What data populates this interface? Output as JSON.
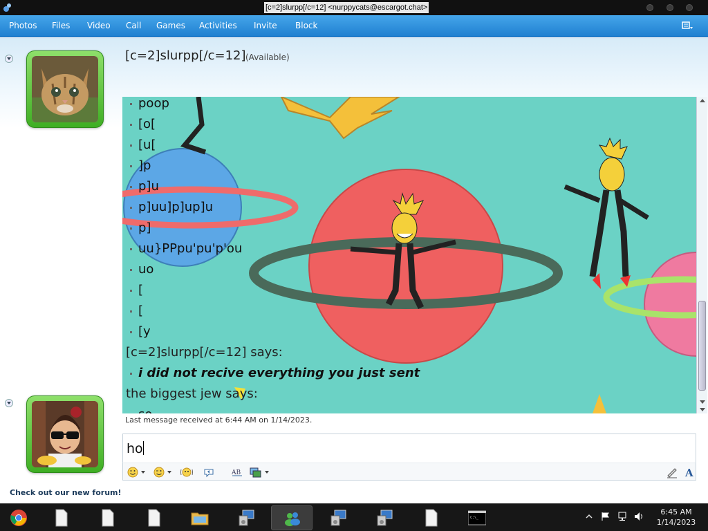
{
  "window": {
    "title": "[c=2]slurpp[/c=12] <nurppycats@escargot.chat>"
  },
  "menu": {
    "items": [
      "Photos",
      "Files",
      "Video",
      "Call",
      "Games",
      "Activities",
      "Invite",
      "Block"
    ]
  },
  "contact": {
    "name": "[c=2]slurpp[/c=12]",
    "status": "(Available)"
  },
  "chat": {
    "lines": [
      {
        "kind": "msg",
        "text": "poop"
      },
      {
        "kind": "msg",
        "text": "[o["
      },
      {
        "kind": "msg",
        "text": "[u["
      },
      {
        "kind": "msg",
        "text": "]p"
      },
      {
        "kind": "msg",
        "text": "p]u"
      },
      {
        "kind": "msg",
        "text": "p]uu]p]up]u"
      },
      {
        "kind": "msg",
        "text": "p]"
      },
      {
        "kind": "msg",
        "text": "uu}PPpu'pu'p'ou"
      },
      {
        "kind": "msg",
        "text": "uo"
      },
      {
        "kind": "msg",
        "text": "["
      },
      {
        "kind": "msg",
        "text": "["
      },
      {
        "kind": "msg",
        "text": "[y"
      },
      {
        "kind": "sender",
        "text": "[c=2]slurpp[/c=12] says:"
      },
      {
        "kind": "msg-bold",
        "text": "i did not recive everything you just sent"
      },
      {
        "kind": "sender",
        "text": "the biggest jew says:"
      },
      {
        "kind": "msg",
        "text": "so"
      }
    ],
    "last_message": "Last message received at 6:44 AM on 1/14/2023."
  },
  "input": {
    "value": "ho"
  },
  "footer": {
    "forum_link": "Check out our new forum!"
  },
  "taskbar": {
    "time": "6:45 AM",
    "date": "1/14/2023"
  },
  "colors": {
    "menubar": "#2b8fdc",
    "chat_bg": "#6bd2c5",
    "avatar_frame": "#4fbe30"
  }
}
